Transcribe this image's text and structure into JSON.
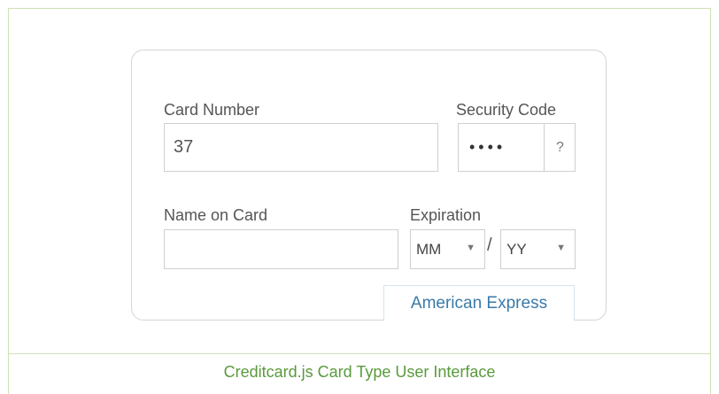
{
  "form": {
    "card_number_label": "Card Number",
    "card_number_value": "37",
    "security_code_label": "Security Code",
    "security_code_value": "••••",
    "security_help": "?",
    "name_label": "Name on Card",
    "name_value": "",
    "expiration_label": "Expiration",
    "month_value": "MM",
    "year_value": "YY",
    "separator": "/",
    "card_type": "American Express"
  },
  "caption": "Creditcard.js Card Type User Interface",
  "colors": {
    "frame_border": "#cfe0b8",
    "caption_text": "#5a9a3c",
    "card_type_text": "#3a7aa8"
  }
}
